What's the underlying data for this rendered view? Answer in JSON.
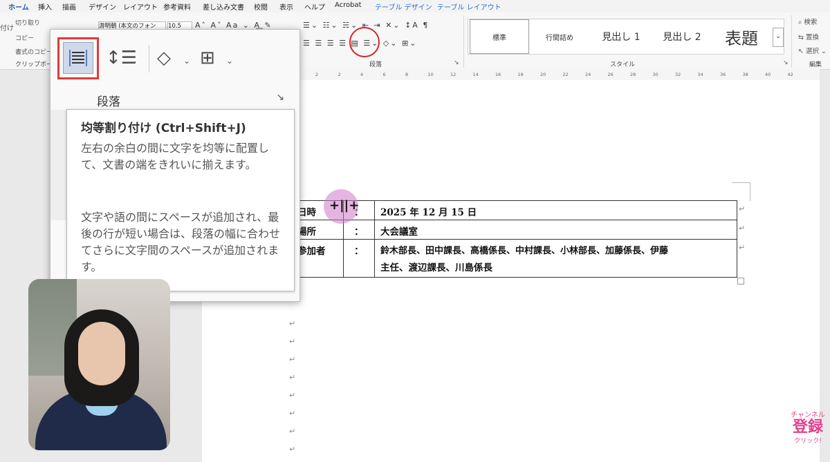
{
  "tabs": [
    "ホーム",
    "挿入",
    "描画",
    "デザイン",
    "レイアウト",
    "参考資料",
    "差し込み文書",
    "校閲",
    "表示",
    "ヘルプ",
    "Acrobat",
    "テーブル デザイン",
    "テーブル レイアウト"
  ],
  "ribbon": {
    "clipboard": {
      "cut": "切り取り",
      "copy": "コピー",
      "format_painter": "書式のコピー",
      "paste": "付け",
      "label": "クリップボード"
    },
    "font": {
      "name": "游明朝 (本文のフォン",
      "size": "10.5"
    },
    "paragraph_label": "段落",
    "styles": {
      "items": [
        "標準",
        "行間詰め",
        "見出し 1",
        "見出し 2",
        "表題"
      ],
      "label": "スタイル"
    },
    "editing": {
      "search": "検索",
      "replace": "置換",
      "select": "選択",
      "label": "編集"
    }
  },
  "ruler": [
    "2",
    "2",
    "4",
    "6",
    "8",
    "10",
    "12",
    "14",
    "16",
    "18",
    "20",
    "22",
    "24",
    "26",
    "28",
    "30",
    "32",
    "34",
    "36",
    "38",
    "40",
    "42"
  ],
  "zoom_panel": {
    "label": "段落"
  },
  "tooltip": {
    "title": "均等割り付け (Ctrl+Shift+J)",
    "p1": "左右の余白の間に文字を均等に配置して、文書の端をきれいに揃えます。",
    "p2": "文字や語の間にスペースが追加され、最後の行が短い場合は、段落の幅に合わせてさらに文字間のスペースが追加されます。"
  },
  "table": {
    "rows": [
      {
        "label": "日時",
        "colon": "：",
        "value": "2025 年 12 月 15 日"
      },
      {
        "label": "場所",
        "colon": "：",
        "value": "大会議室"
      },
      {
        "label": "参加者",
        "colon": "：",
        "value": "鈴木部長、田中課長、高橋係長、中村課長、小林部長、加藤係長、伊藤",
        "value2": "主任、渡辺課長、川島係長"
      }
    ]
  },
  "paragraph_mark": "↵",
  "subscribe": {
    "top": "チャンネル",
    "main": "登録",
    "bottom": "クリック!"
  }
}
